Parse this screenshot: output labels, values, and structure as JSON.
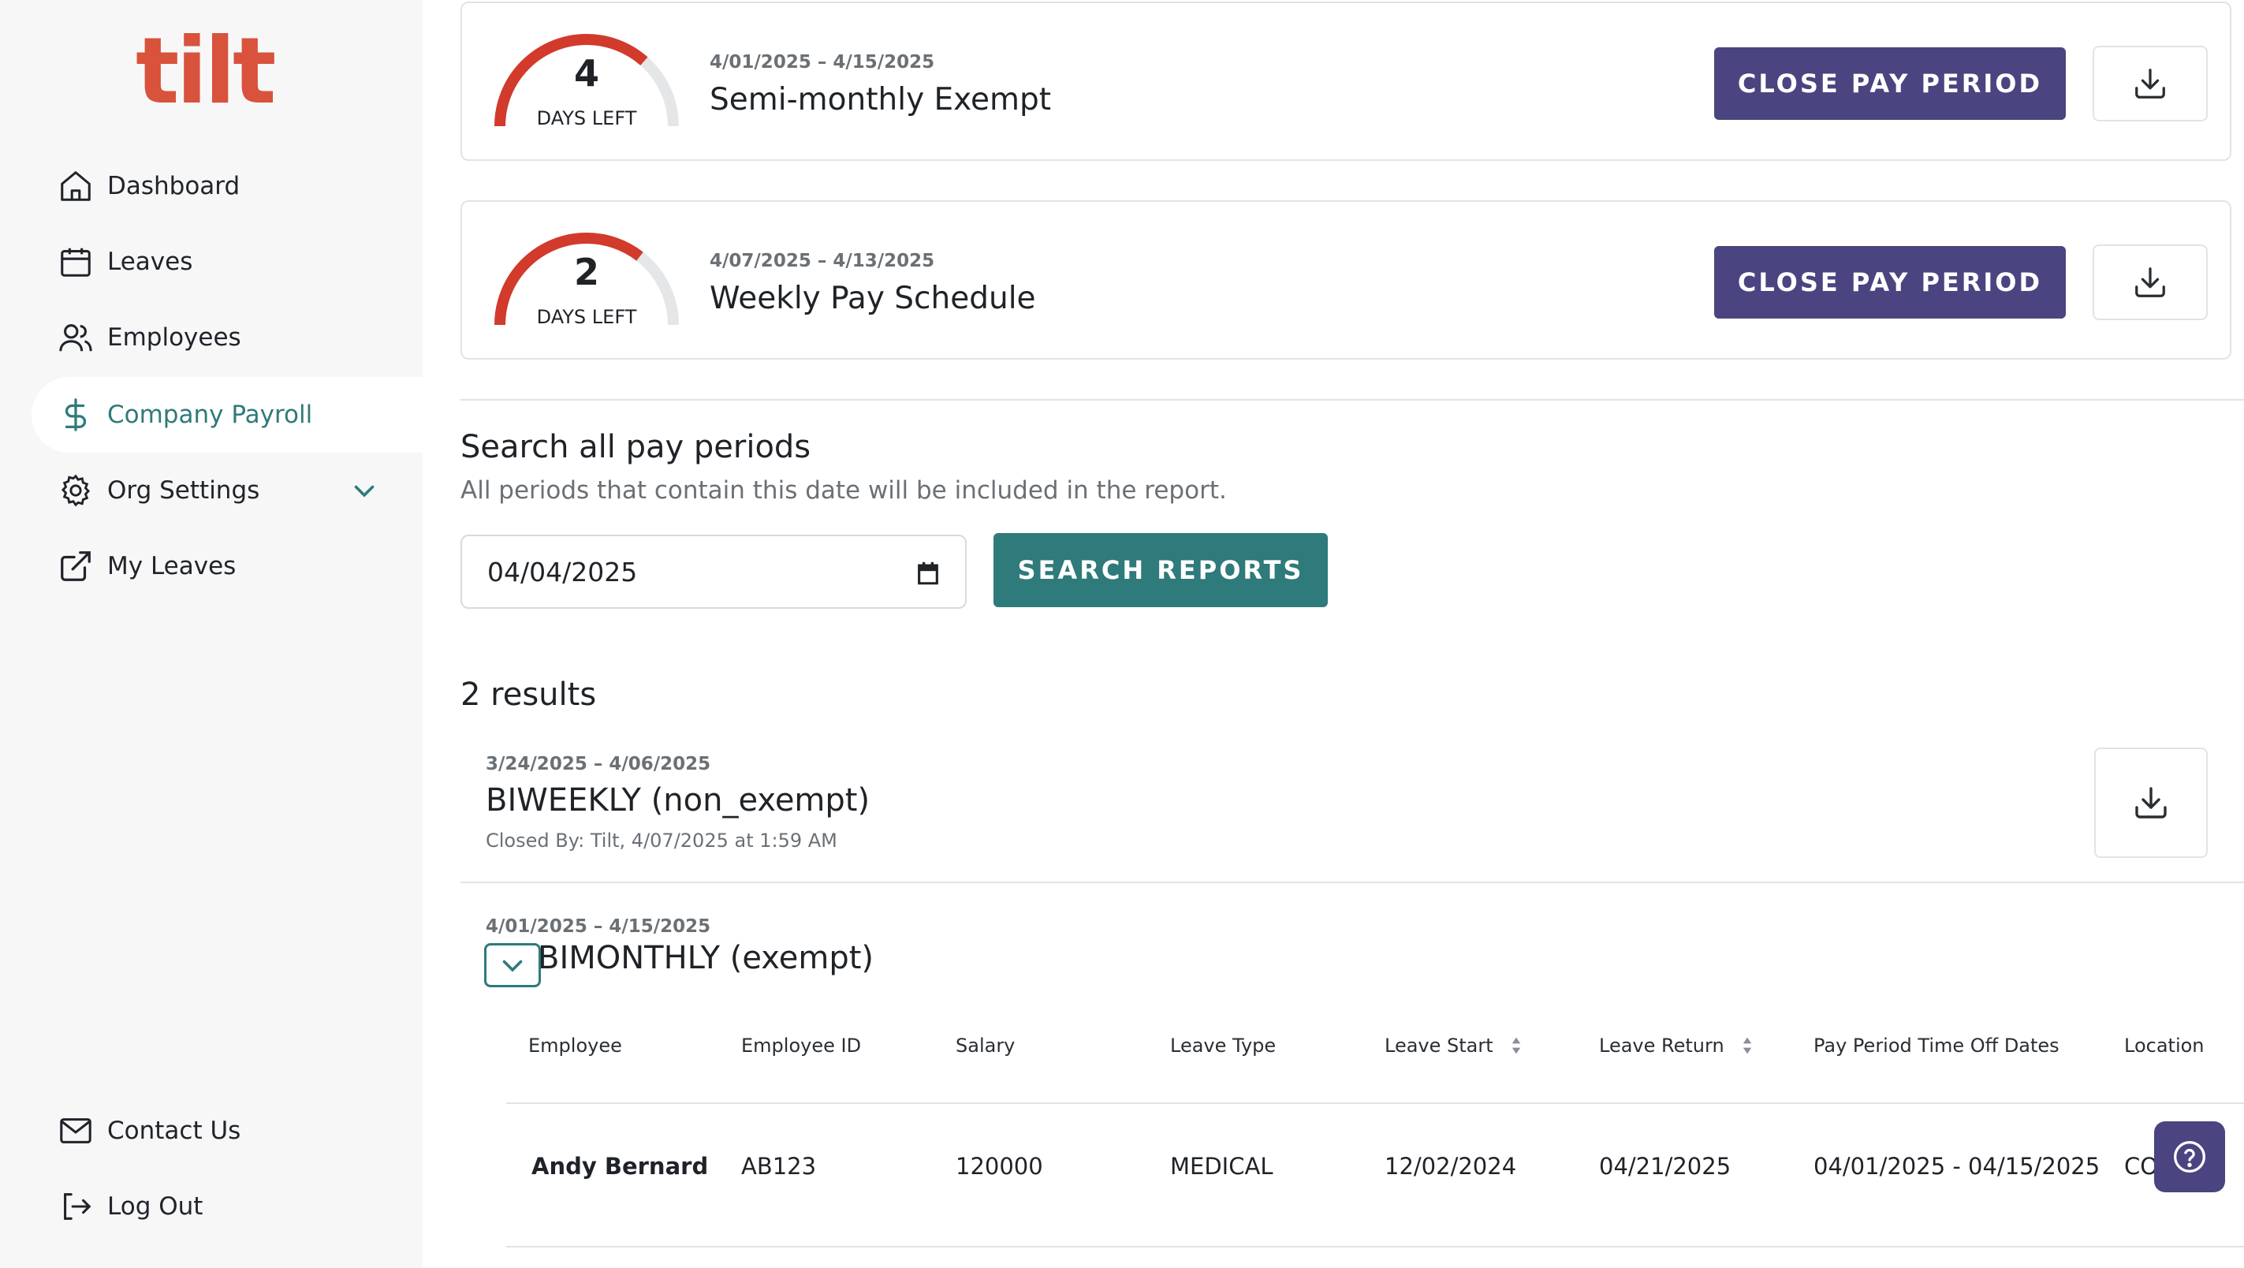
{
  "brand": {
    "logo_text": "tilt",
    "logo_color": "#d8523c"
  },
  "sidebar": {
    "items": [
      {
        "label": "Dashboard",
        "icon": "home-icon"
      },
      {
        "label": "Leaves",
        "icon": "calendar-icon"
      },
      {
        "label": "Employees",
        "icon": "users-icon"
      },
      {
        "label": "Company Payroll",
        "icon": "dollar-icon",
        "active": true
      },
      {
        "label": "Org Settings",
        "icon": "gear-icon",
        "expandable": true
      },
      {
        "label": "My Leaves",
        "icon": "external-link-icon"
      }
    ],
    "bottom_items": [
      {
        "label": "Contact Us",
        "icon": "mail-icon"
      },
      {
        "label": "Log Out",
        "icon": "logout-icon"
      }
    ]
  },
  "pay_periods": [
    {
      "days_left": "4",
      "days_left_label": "DAYS LEFT",
      "progress": 0.73,
      "dates": "4/01/2025 – 4/15/2025",
      "title": "Semi-monthly Exempt",
      "close_label": "CLOSE PAY PERIOD"
    },
    {
      "days_left": "2",
      "days_left_label": "DAYS LEFT",
      "progress": 0.71,
      "dates": "4/07/2025 – 4/13/2025",
      "title": "Weekly Pay Schedule",
      "close_label": "CLOSE PAY PERIOD"
    }
  ],
  "search": {
    "title": "Search all pay periods",
    "subtitle": "All periods that contain this date will be included in the report.",
    "date_value": "04/04/2025",
    "button_label": "SEARCH REPORTS"
  },
  "results": {
    "count_label": "2 results",
    "items": [
      {
        "dates": "3/24/2025 – 4/06/2025",
        "title": "BIWEEKLY (non_exempt)",
        "closed_by": "Closed By: Tilt, 4/07/2025 at 1:59 AM"
      },
      {
        "dates": "4/01/2025 – 4/15/2025",
        "title": "BIMONTHLY (exempt)"
      }
    ]
  },
  "table": {
    "headers": [
      "Employee",
      "Employee ID",
      "Salary",
      "Leave Type",
      "Leave Start",
      "Leave Return",
      "Pay Period Time Off Dates",
      "Location"
    ],
    "rows": [
      [
        "Andy Bernard",
        "AB123",
        "120000",
        "MEDICAL",
        "12/02/2024",
        "04/21/2025",
        "04/01/2025 - 04/15/2025",
        "CO"
      ]
    ]
  },
  "colors": {
    "accent": "#2f7a7a",
    "primary_button": "#4a4480",
    "gauge_arc": "#d23a2b",
    "gauge_track": "#e4e6e8"
  }
}
